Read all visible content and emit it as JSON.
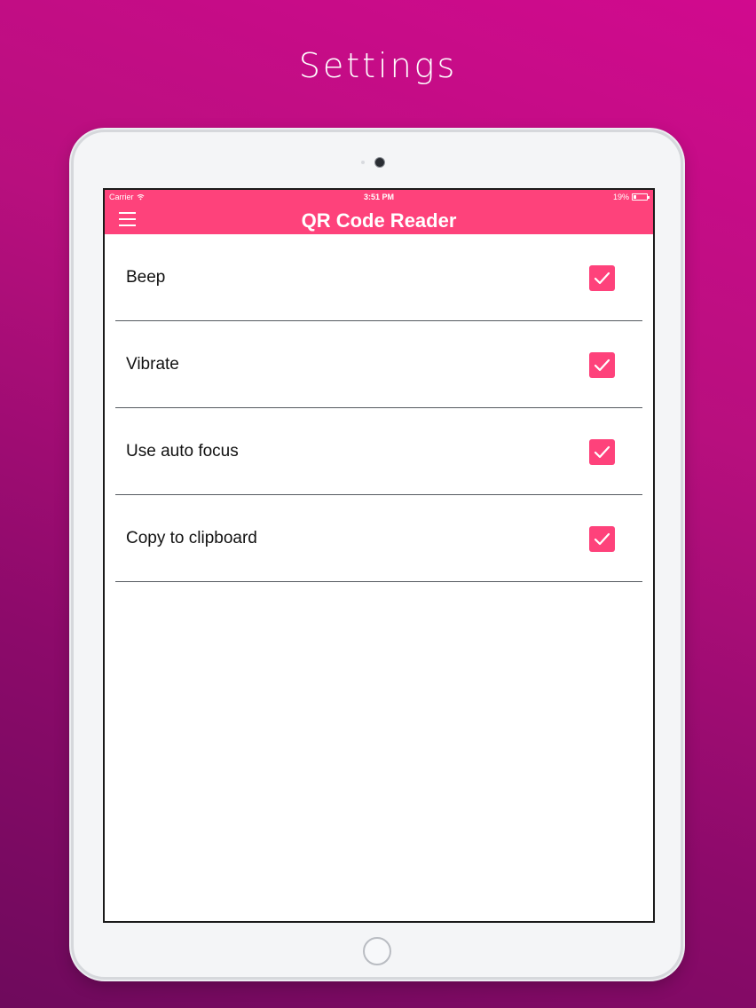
{
  "promo": {
    "title": "Settings"
  },
  "status_bar": {
    "carrier": "Carrier",
    "time": "3:51 PM",
    "battery": "19%"
  },
  "app_bar": {
    "title": "QR Code Reader",
    "menu_icon": "hamburger-menu-icon"
  },
  "settings": [
    {
      "label": "Beep",
      "checked": true
    },
    {
      "label": "Vibrate",
      "checked": true
    },
    {
      "label": "Use auto focus",
      "checked": true
    },
    {
      "label": "Copy to clipboard",
      "checked": true
    }
  ],
  "colors": {
    "accent": "#fe427b",
    "background_top": "#d10a8e",
    "background_bottom": "#6e0a5c"
  }
}
